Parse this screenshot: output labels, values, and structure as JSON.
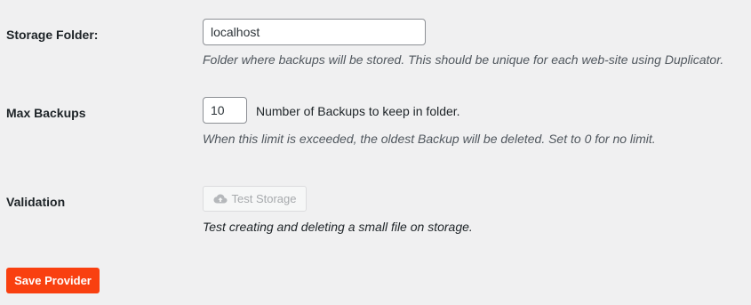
{
  "storage_folder": {
    "label": "Storage Folder:",
    "value": "localhost",
    "description": "Folder where backups will be stored. This should be unique for each web-site using Duplicator."
  },
  "max_backups": {
    "label": "Max Backups",
    "value": "10",
    "inline_text": "Number of Backups to keep in folder.",
    "description": "When this limit is exceeded, the oldest Backup will be deleted. Set to 0 for no limit."
  },
  "validation": {
    "label": "Validation",
    "button_label": "Test Storage",
    "button_icon": "cloud-upload-icon",
    "description": "Test creating and deleting a small file on storage."
  },
  "save_button_label": "Save Provider",
  "colors": {
    "background": "#f0f0f1",
    "save_button": "#f94010",
    "disabled_text": "#a7aaad"
  }
}
